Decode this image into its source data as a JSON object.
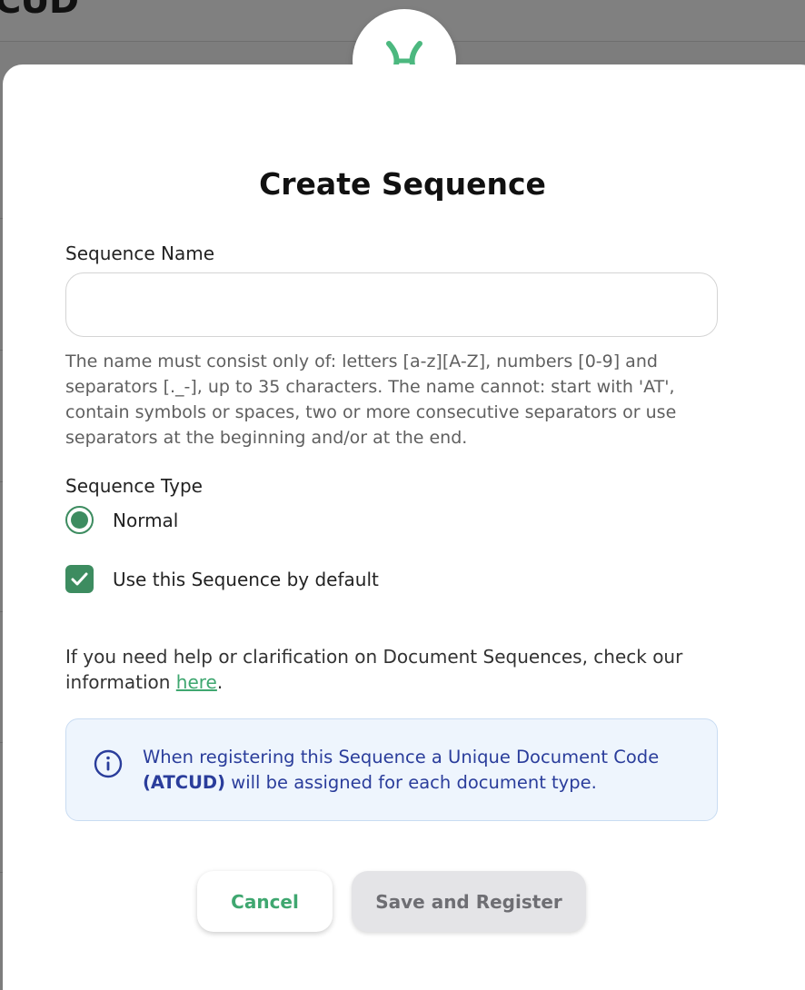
{
  "background": {
    "logo_text": "CUD"
  },
  "modal": {
    "title": "Create Sequence",
    "sequence_name": {
      "label": "Sequence Name",
      "value": "",
      "placeholder": "",
      "hint": "The name must consist only of: letters [a-z][A-Z], numbers [0-9] and separators [._-], up to 35 characters. The name cannot: start with 'AT', contain symbols or spaces, two or more consecutive separators or use separators at the beginning and/or at the end."
    },
    "sequence_type": {
      "label": "Sequence Type",
      "options": [
        {
          "label": "Normal",
          "selected": true
        }
      ]
    },
    "default_checkbox": {
      "label": "Use this Sequence by default",
      "checked": true
    },
    "help": {
      "text_before": "If you need help or clarification on Document Sequences, check our information ",
      "link_text": "here",
      "text_after": "."
    },
    "info": {
      "text_before": "When registering this Sequence a Unique Document Code ",
      "bold_text": "(ATCUD)",
      "text_after": " will be assigned for each document type."
    },
    "buttons": {
      "cancel": "Cancel",
      "save": "Save and Register"
    }
  },
  "colors": {
    "accent": "#3d8c60",
    "link": "#3fa770",
    "info_text": "#2a3d9b",
    "info_bg": "#eef5fd",
    "disabled_bg": "#e4e4e7"
  },
  "icons": {
    "logo": "x-logo-icon",
    "radio": "radio-selected-icon",
    "check": "checkmark-icon",
    "info": "info-circle-icon"
  }
}
